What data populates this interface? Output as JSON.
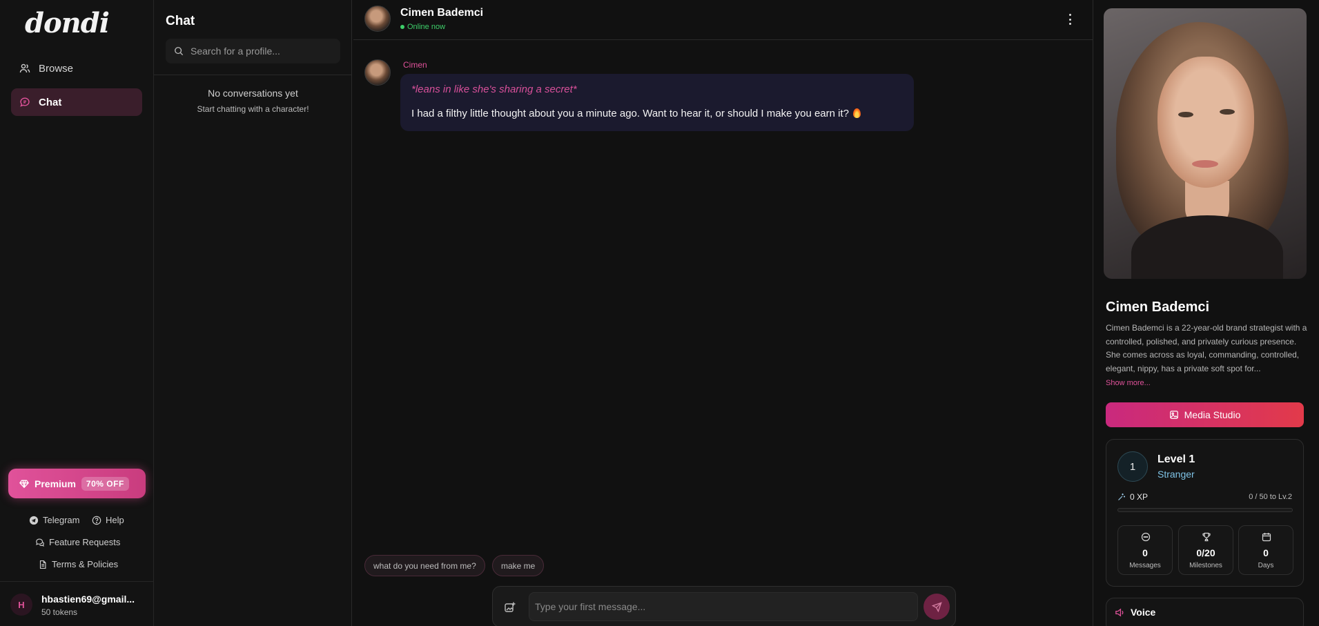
{
  "nav": {
    "logo": "dondi",
    "items": [
      {
        "label": "Browse",
        "icon": "users-icon",
        "active": false
      },
      {
        "label": "Chat",
        "icon": "chat-icon",
        "active": true
      }
    ],
    "premium": {
      "label": "Premium",
      "badge": "70% OFF"
    },
    "links": {
      "telegram": "Telegram",
      "help": "Help",
      "feature_requests": "Feature Requests",
      "terms": "Terms & Policies"
    },
    "user": {
      "initial": "H",
      "email": "hbastien69@gmail...",
      "tokens": "50 tokens"
    }
  },
  "chatlist": {
    "title": "Chat",
    "search_placeholder": "Search for a profile...",
    "empty_title": "No conversations yet",
    "empty_subtitle": "Start chatting with a character!"
  },
  "chat": {
    "header": {
      "name": "Cimen Bademci",
      "status": "Online now"
    },
    "messages": [
      {
        "sender": "Cimen",
        "action": "*leans in like she's sharing a secret*",
        "text": "I had a filthy little thought about you a minute ago. Want to hear it, or should I make you earn it?"
      }
    ],
    "suggestions": [
      "what do you need from me?",
      "make me"
    ],
    "composer_placeholder": "Type your first message..."
  },
  "profile": {
    "name": "Cimen Bademci",
    "description": "Cimen Bademci is a 22-year-old brand strategist with a controlled, polished, and privately curious presence. She comes across as loyal, commanding, controlled, elegant, nippy, has a private soft spot for...",
    "show_more": "Show more...",
    "media_button": "Media Studio",
    "level": {
      "number": "1",
      "title": "Level 1",
      "rank": "Stranger",
      "xp": "0 XP",
      "next": "0 / 50 to Lv.2",
      "progress": 0
    },
    "stats": [
      {
        "value": "0",
        "label": "Messages",
        "icon": "message-circle-icon"
      },
      {
        "value": "0/20",
        "label": "Milestones",
        "icon": "trophy-icon"
      },
      {
        "value": "0",
        "label": "Days",
        "icon": "calendar-icon"
      }
    ],
    "voice_label": "Voice"
  },
  "colors": {
    "accent": "#e0529a",
    "online": "#3ecf6a",
    "rank": "#7fc3e6"
  }
}
